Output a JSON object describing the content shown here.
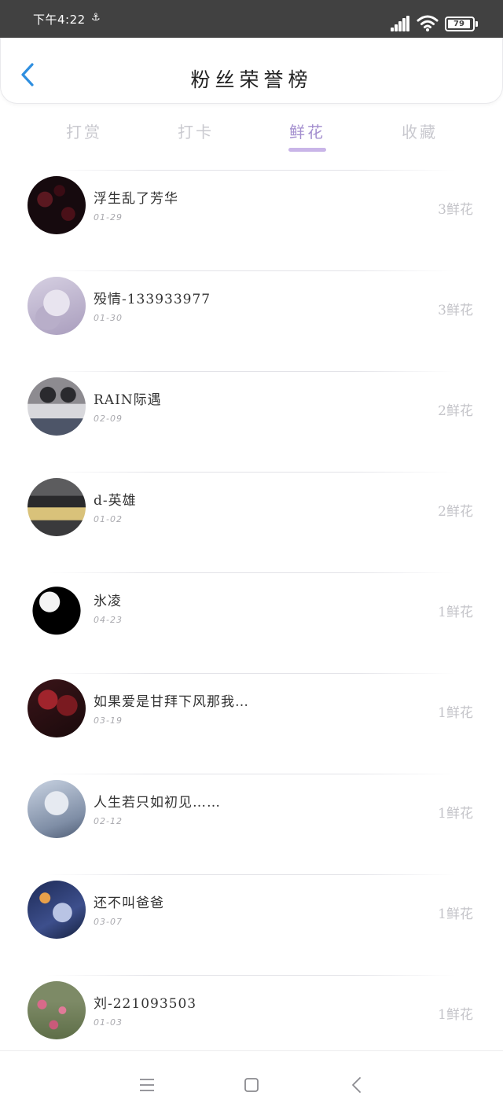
{
  "status_bar": {
    "time": "下午4:22",
    "extra_icon": "notification-icon",
    "battery_level": "79"
  },
  "header": {
    "title": "粉丝荣誉榜"
  },
  "tabs": [
    {
      "label": "打赏",
      "active": false
    },
    {
      "label": "打卡",
      "active": false
    },
    {
      "label": "鲜花",
      "active": true
    },
    {
      "label": "收藏",
      "active": false
    }
  ],
  "fans": [
    {
      "name": "浮生乱了芳华",
      "date": "01-29",
      "count": "3鲜花"
    },
    {
      "name": "殁情-133933977",
      "date": "01-30",
      "count": "3鲜花"
    },
    {
      "name": "RAIN际遇",
      "date": "02-09",
      "count": "2鲜花"
    },
    {
      "name": "d-英雄",
      "date": "01-02",
      "count": "2鲜花"
    },
    {
      "name": "氷凌",
      "date": "04-23",
      "count": "1鲜花"
    },
    {
      "name": "如果爱是甘拜下风那我…",
      "date": "03-19",
      "count": "1鲜花"
    },
    {
      "name": "人生若只如初见……",
      "date": "02-12",
      "count": "1鲜花"
    },
    {
      "name": "还不叫爸爸",
      "date": "03-07",
      "count": "1鲜花"
    },
    {
      "name": "刘-221093503",
      "date": "01-03",
      "count": "1鲜花"
    }
  ],
  "nav_bar": {
    "icons": [
      "menu-icon",
      "home-square-icon",
      "back-triangle-icon"
    ]
  },
  "colors": {
    "status_bar": "#414141",
    "back_arrow": "#2f8fe0",
    "tab_active": "#a48fcf",
    "tab_indicator": "#c9b5e8",
    "tab_inactive": "#c9c9cf"
  }
}
